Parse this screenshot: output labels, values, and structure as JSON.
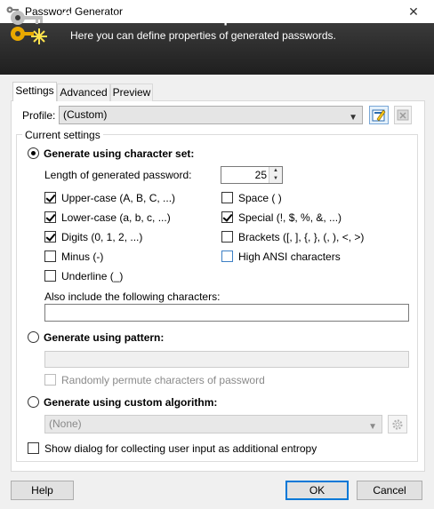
{
  "window": {
    "title": "Password Generator",
    "close_glyph": "✕"
  },
  "banner": {
    "title": "Password Generation Options",
    "subtitle": "Here you can define properties of generated passwords."
  },
  "tabs": [
    {
      "label": "Settings",
      "active": true
    },
    {
      "label": "Advanced",
      "active": false
    },
    {
      "label": "Preview",
      "active": false
    }
  ],
  "profile": {
    "label": "Profile:",
    "value": "(Custom)"
  },
  "group": {
    "caption": "Current settings"
  },
  "charset": {
    "label": "Generate using character set:",
    "selected": true,
    "length_label": "Length of generated password:",
    "length_value": "25",
    "options": [
      {
        "label": "Upper-case (A, B, C, ...)",
        "checked": true
      },
      {
        "label": "Lower-case (a, b, c, ...)",
        "checked": true
      },
      {
        "label": "Digits (0, 1, 2, ...)",
        "checked": true
      },
      {
        "label": "Minus (-)",
        "checked": false
      },
      {
        "label": "Underline (_)",
        "checked": false
      },
      {
        "label": "Space ( )",
        "checked": false
      },
      {
        "label": "Special (!, $, %, &, ...)",
        "checked": true
      },
      {
        "label": "Brackets ([, ], {, }, (, ), <, >)",
        "checked": false
      },
      {
        "label": "High ANSI characters",
        "checked": false
      }
    ],
    "also_include_label": "Also include the following characters:",
    "also_include_value": ""
  },
  "pattern": {
    "label": "Generate using pattern:",
    "selected": false,
    "value": "",
    "permute_label": "Randomly permute characters of password"
  },
  "custom": {
    "label": "Generate using custom algorithm:",
    "selected": false,
    "value": "(None)"
  },
  "entropy": {
    "label": "Show dialog for collecting user input as additional entropy",
    "checked": false
  },
  "buttons": {
    "help": "Help",
    "ok": "OK",
    "cancel": "Cancel"
  },
  "colors": {
    "banner_bg": "#2b2b2b",
    "accent": "#0078d7"
  }
}
